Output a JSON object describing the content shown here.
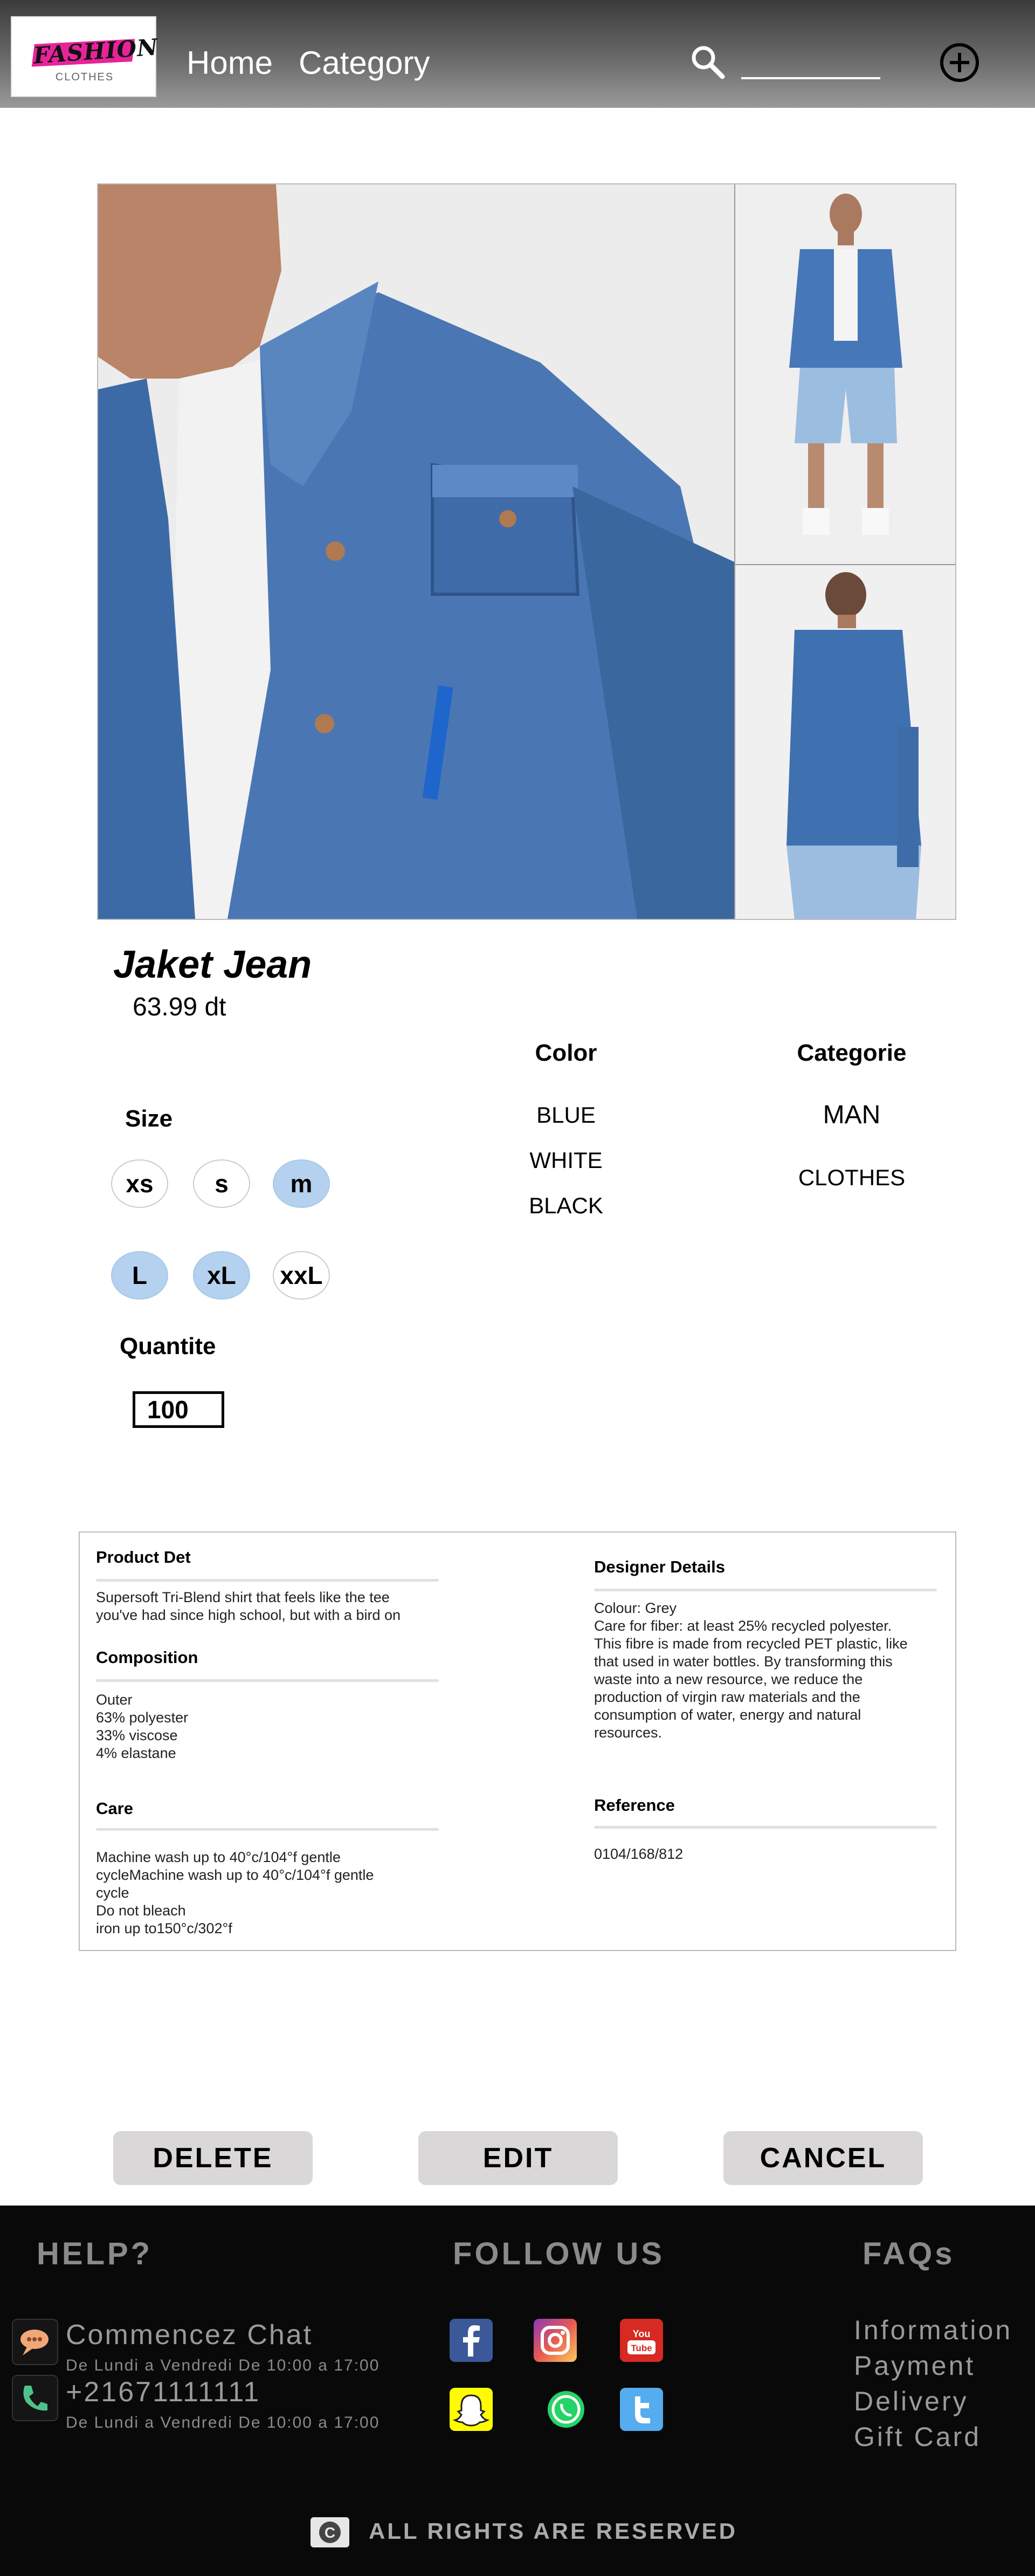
{
  "header": {
    "logo_text": "FASHION",
    "logo_sub": "CLOTHES",
    "nav": [
      {
        "label": "Home"
      },
      {
        "label": "Category"
      }
    ],
    "search_value": ""
  },
  "product": {
    "name": "Jaket Jean",
    "price": "63.99 dt",
    "size_label": "Size",
    "sizes": [
      {
        "label": "xs",
        "selected": false
      },
      {
        "label": "s",
        "selected": false
      },
      {
        "label": "m",
        "selected": true
      },
      {
        "label": "L",
        "selected": true
      },
      {
        "label": "xL",
        "selected": true
      },
      {
        "label": "xxL",
        "selected": false
      }
    ],
    "quantity_label": "Quantite",
    "quantity": "100",
    "color_title": "Color",
    "colors": [
      "BLUE",
      "WHITE",
      "BLACK"
    ],
    "category_title": "Categorie",
    "categories": [
      "MAN",
      "CLOTHES"
    ]
  },
  "details": {
    "product_det_title": "Product Det",
    "product_det_lines": [
      "Supersoft Tri-Blend shirt that feels like the tee",
      "you've had since high school, but with a bird on"
    ],
    "composition_title": "Composition",
    "composition_lines": [
      "Outer",
      "63% polyester",
      "33% viscose",
      "4% elastane"
    ],
    "care_title": "Care",
    "care_lines": [
      "Machine wash up to 40°c/104°f gentle",
      "cycleMachine wash up to 40°c/104°f gentle",
      "cycle",
      "Do not bleach",
      "iron up to150°c/302°f"
    ],
    "designer_title": "Designer Details",
    "designer_lines": [
      "Colour: Grey",
      "Care for fiber: at least 25% recycled polyester.",
      "This fibre is made from recycled PET plastic, like",
      "that used in water bottles. By transforming this",
      "waste into a new resource, we reduce the",
      "production of virgin raw materials and the",
      "consumption of water, energy and natural",
      "resources."
    ],
    "reference_title": "Reference",
    "reference_value": "0104/168/812"
  },
  "actions": {
    "delete": "DELETE",
    "edit": "EDIT",
    "cancel": "CANCEL"
  },
  "footer": {
    "help_title": "HELP?",
    "chat_label": "Commencez Chat",
    "chat_hours": "De Lundi a Vendredi De 10:00 a 17:00",
    "phone": "+21671111111",
    "phone_hours": "De Lundi a Vendredi De 10:00 a 17:00",
    "follow_title": "FOLLOW US",
    "faq_title": "FAQs",
    "faq_links": [
      "Information",
      "Payment",
      "Delivery",
      "Gift Card"
    ],
    "copyright": "ALL RIGHTS ARE RESERVED"
  },
  "colors": {
    "selected_size": "#b4d2ef",
    "footer_bg": "#090909",
    "button_bg": "#d9d7d7",
    "logo_accent": "#e8239a"
  }
}
